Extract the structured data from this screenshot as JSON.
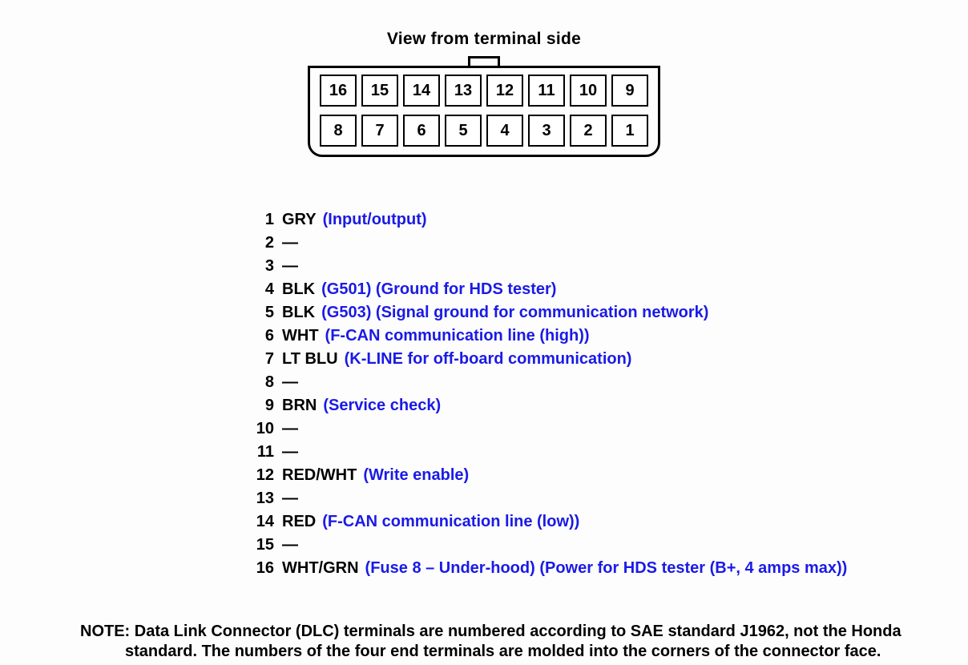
{
  "title": "View from terminal side",
  "connector": {
    "top_row": [
      "16",
      "15",
      "14",
      "13",
      "12",
      "11",
      "10",
      "9"
    ],
    "bottom_row": [
      "8",
      "7",
      "6",
      "5",
      "4",
      "3",
      "2",
      "1"
    ]
  },
  "pins": [
    {
      "n": "1",
      "color": "GRY",
      "desc": "(Input/output)"
    },
    {
      "n": "2",
      "color": "",
      "desc": ""
    },
    {
      "n": "3",
      "color": "",
      "desc": ""
    },
    {
      "n": "4",
      "color": "BLK",
      "desc": "(G501) (Ground for HDS tester)"
    },
    {
      "n": "5",
      "color": "BLK",
      "desc": "(G503) (Signal ground for communication network)"
    },
    {
      "n": "6",
      "color": "WHT",
      "desc": "(F-CAN communication line (high))"
    },
    {
      "n": "7",
      "color": "LT BLU",
      "desc": "(K-LINE for off-board communication)"
    },
    {
      "n": "8",
      "color": "",
      "desc": ""
    },
    {
      "n": "9",
      "color": "BRN",
      "desc": "(Service check)"
    },
    {
      "n": "10",
      "color": "",
      "desc": ""
    },
    {
      "n": "11",
      "color": "",
      "desc": ""
    },
    {
      "n": "12",
      "color": "RED/WHT",
      "desc": "(Write enable)"
    },
    {
      "n": "13",
      "color": "",
      "desc": ""
    },
    {
      "n": "14",
      "color": "RED",
      "desc": "(F-CAN communication line (low))"
    },
    {
      "n": "15",
      "color": "",
      "desc": ""
    },
    {
      "n": "16",
      "color": "WHT/GRN",
      "desc": "(Fuse 8 – Under-hood) (Power for HDS tester (B+, 4 amps max))"
    }
  ],
  "note": "NOTE: Data Link Connector (DLC) terminals are numbered according to SAE standard J1962, not the Honda standard. The numbers of the four end terminals are molded into the corners of the connector face.",
  "dash": "—"
}
